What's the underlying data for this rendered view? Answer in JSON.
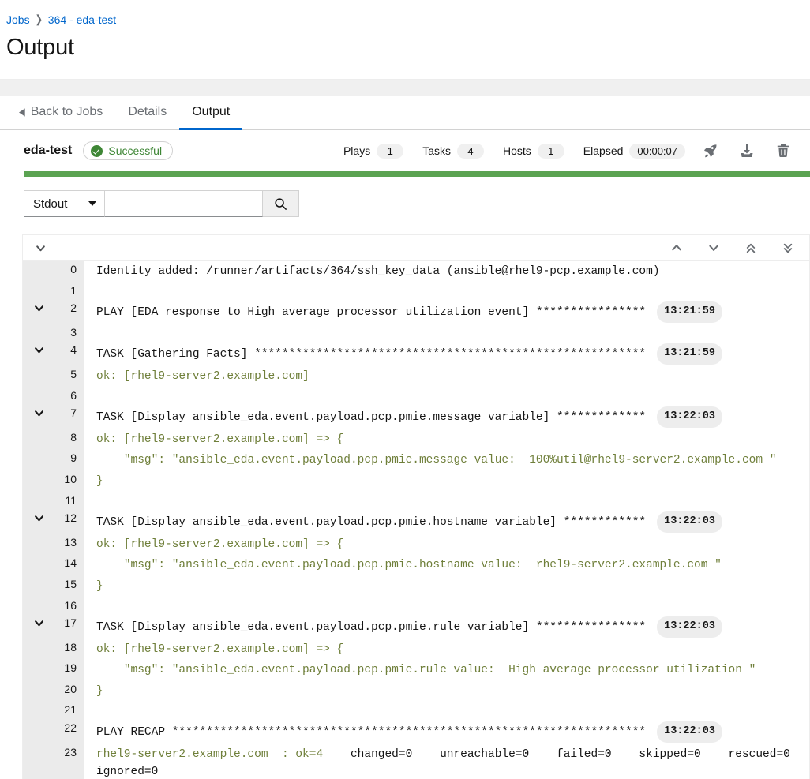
{
  "breadcrumb": {
    "items": [
      {
        "label": "Jobs",
        "link": true
      },
      {
        "label": "364 - eda-test",
        "link": true
      }
    ],
    "separator": "❯"
  },
  "page_title": "Output",
  "tabs": [
    {
      "label": "Back to Jobs",
      "active": false,
      "has_back_caret": true
    },
    {
      "label": "Details",
      "active": false
    },
    {
      "label": "Output",
      "active": true
    }
  ],
  "job_header": {
    "name": "eda-test",
    "status": "Successful",
    "status_color": "#3e8635",
    "stats": [
      {
        "label": "Plays",
        "value": "1"
      },
      {
        "label": "Tasks",
        "value": "4"
      },
      {
        "label": "Hosts",
        "value": "1"
      },
      {
        "label": "Elapsed",
        "value": "00:00:07"
      }
    ],
    "actions": [
      {
        "name": "relaunch-icon",
        "title": "Relaunch"
      },
      {
        "name": "download-icon",
        "title": "Download"
      },
      {
        "name": "delete-icon",
        "title": "Delete"
      }
    ]
  },
  "progress": {
    "percent": 100,
    "color": "#5ba352"
  },
  "search": {
    "select_value": "Stdout",
    "select_options": [
      "Stdout"
    ],
    "input_value": "",
    "input_placeholder": "",
    "button_icon": "search-icon"
  },
  "console_toolbar": {
    "expand_all_icon": "chevron-down-icon",
    "nav_icons": [
      {
        "name": "scroll-previous-icon",
        "glyph": "up"
      },
      {
        "name": "scroll-next-icon",
        "glyph": "down"
      },
      {
        "name": "scroll-first-icon",
        "glyph": "double-up"
      },
      {
        "name": "scroll-last-icon",
        "glyph": "double-down"
      }
    ]
  },
  "output_lines": [
    {
      "num": "0",
      "toggle": false,
      "color": "default",
      "text": "Identity added: /runner/artifacts/364/ssh_key_data (ansible@rhel9-pcp.example.com)",
      "timestamp": ""
    },
    {
      "num": "1",
      "toggle": false,
      "color": "default",
      "text": "",
      "timestamp": ""
    },
    {
      "num": "2",
      "toggle": true,
      "color": "default",
      "text": "PLAY [EDA response to High average processor utilization event] ****************",
      "timestamp": "13:21:59"
    },
    {
      "num": "3",
      "toggle": false,
      "color": "default",
      "text": "",
      "timestamp": ""
    },
    {
      "num": "4",
      "toggle": true,
      "color": "default",
      "text": "TASK [Gathering Facts] *********************************************************",
      "timestamp": "13:21:59"
    },
    {
      "num": "5",
      "toggle": false,
      "color": "green",
      "text": "ok: [rhel9-server2.example.com]",
      "timestamp": ""
    },
    {
      "num": "6",
      "toggle": false,
      "color": "default",
      "text": "",
      "timestamp": ""
    },
    {
      "num": "7",
      "toggle": true,
      "color": "default",
      "text": "TASK [Display ansible_eda.event.payload.pcp.pmie.message variable] *************",
      "timestamp": "13:22:03"
    },
    {
      "num": "8",
      "toggle": false,
      "color": "green",
      "text": "ok: [rhel9-server2.example.com] => {",
      "timestamp": ""
    },
    {
      "num": "9",
      "toggle": false,
      "color": "green",
      "text": "    \"msg\": \"ansible_eda.event.payload.pcp.pmie.message value:  100%util@rhel9-server2.example.com \"",
      "timestamp": ""
    },
    {
      "num": "10",
      "toggle": false,
      "color": "green",
      "text": "}",
      "timestamp": ""
    },
    {
      "num": "11",
      "toggle": false,
      "color": "default",
      "text": "",
      "timestamp": ""
    },
    {
      "num": "12",
      "toggle": true,
      "color": "default",
      "text": "TASK [Display ansible_eda.event.payload.pcp.pmie.hostname variable] ************",
      "timestamp": "13:22:03"
    },
    {
      "num": "13",
      "toggle": false,
      "color": "green",
      "text": "ok: [rhel9-server2.example.com] => {",
      "timestamp": ""
    },
    {
      "num": "14",
      "toggle": false,
      "color": "green",
      "text": "    \"msg\": \"ansible_eda.event.payload.pcp.pmie.hostname value:  rhel9-server2.example.com \"",
      "timestamp": ""
    },
    {
      "num": "15",
      "toggle": false,
      "color": "green",
      "text": "}",
      "timestamp": ""
    },
    {
      "num": "16",
      "toggle": false,
      "color": "default",
      "text": "",
      "timestamp": ""
    },
    {
      "num": "17",
      "toggle": true,
      "color": "default",
      "text": "TASK [Display ansible_eda.event.payload.pcp.pmie.rule variable] ****************",
      "timestamp": "13:22:03"
    },
    {
      "num": "18",
      "toggle": false,
      "color": "green",
      "text": "ok: [rhel9-server2.example.com] => {",
      "timestamp": ""
    },
    {
      "num": "19",
      "toggle": false,
      "color": "green",
      "text": "    \"msg\": \"ansible_eda.event.payload.pcp.pmie.rule value:  High average processor utilization \"",
      "timestamp": ""
    },
    {
      "num": "20",
      "toggle": false,
      "color": "green",
      "text": "}",
      "timestamp": ""
    },
    {
      "num": "21",
      "toggle": false,
      "color": "default",
      "text": "",
      "timestamp": ""
    },
    {
      "num": "22",
      "toggle": false,
      "color": "default",
      "text": "PLAY RECAP *********************************************************************",
      "timestamp": "13:22:03"
    },
    {
      "num": "23",
      "toggle": false,
      "color": "recap",
      "text": "rhel9-server2.example.com  : ok=4    changed=0    unreachable=0    failed=0    skipped=0    rescued=0    ignored=0",
      "recap_green": "rhel9-server2.example.com  : ok=4",
      "recap_rest": "    changed=0    unreachable=0    failed=0    skipped=0    rescued=0    ignored=0",
      "timestamp": ""
    }
  ]
}
